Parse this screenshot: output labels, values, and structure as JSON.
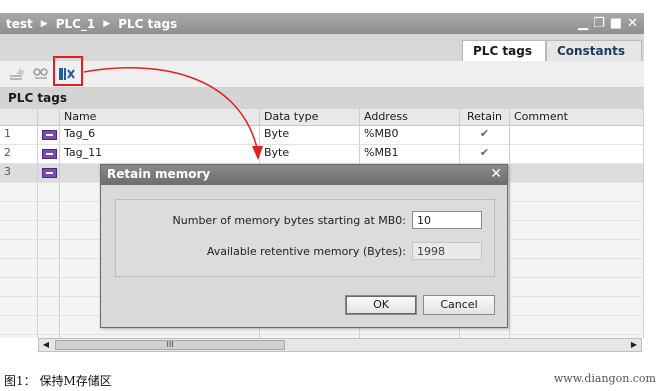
{
  "titlebar": {
    "breadcrumb": [
      "test",
      "PLC_1",
      "PLC tags"
    ],
    "separator": "▶"
  },
  "tabs": [
    {
      "label": "PLC tags",
      "active": true
    },
    {
      "label": "Constants",
      "active": false
    }
  ],
  "section_title": "PLC tags",
  "table": {
    "headers": {
      "name": "Name",
      "data_type": "Data type",
      "address": "Address",
      "retain": "Retain",
      "comment": "Comment"
    },
    "rows": [
      {
        "num": "1",
        "name": "Tag_6",
        "data_type": "Byte",
        "address": "%MB0",
        "retain": "✔"
      },
      {
        "num": "2",
        "name": "Tag_11",
        "data_type": "Byte",
        "address": "%MB1",
        "retain": "✔"
      },
      {
        "num": "3",
        "name": "",
        "data_type": "",
        "address": "",
        "retain": ""
      }
    ]
  },
  "scrollbar": {
    "thumb_label": "III",
    "left_arrow": "◀",
    "right_arrow": "▶"
  },
  "dialog": {
    "title": "Retain memory",
    "close": "✕",
    "bytes_label": "Number of memory bytes starting at MB0:",
    "bytes_value": "10",
    "available_label": "Available retentive memory (Bytes):",
    "available_value": "1998",
    "ok_label": "OK",
    "cancel_label": "Cancel"
  },
  "caption": "图1： 保持M存储区",
  "watermark": "www.diangon.com",
  "colors": {
    "highlight": "#e02020",
    "tag_icon": "#7a4bb2"
  }
}
